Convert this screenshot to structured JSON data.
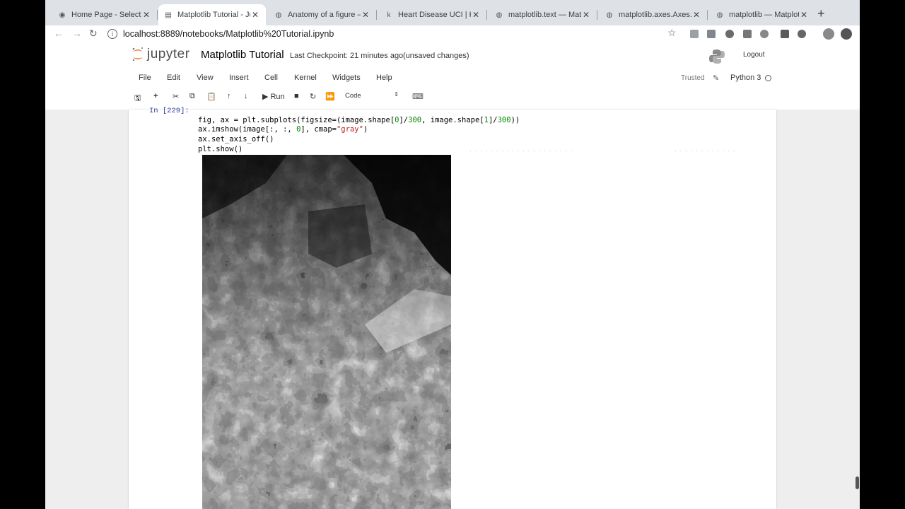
{
  "browser": {
    "tabs": [
      {
        "title": "Home Page - Select or",
        "icon": "jupyter-favicon",
        "active": false
      },
      {
        "title": "Matplotlib Tutorial - Ju",
        "icon": "notebook-favicon",
        "active": true
      },
      {
        "title": "Anatomy of a figure —",
        "icon": "matplotlib-favicon",
        "active": false
      },
      {
        "title": "Heart Disease UCI | K",
        "icon": "kaggle-favicon",
        "active": false
      },
      {
        "title": "matplotlib.text — Mat",
        "icon": "matplotlib-favicon",
        "active": false
      },
      {
        "title": "matplotlib.axes.Axes.t",
        "icon": "matplotlib-favicon",
        "active": false
      },
      {
        "title": "matplotlib — Matplotli",
        "icon": "matplotlib-favicon",
        "active": false
      }
    ],
    "close_glyph": "✕",
    "new_tab_glyph": "+",
    "url": "localhost:8889/notebooks/Matplotlib%20Tutorial.ipynb"
  },
  "jupyter": {
    "logo_text": "jupyter",
    "notebook_title": "Matplotlib Tutorial",
    "checkpoint": "Last Checkpoint: 21 minutes ago",
    "unsaved": "(unsaved changes)",
    "logout": "Logout",
    "menus": [
      "File",
      "Edit",
      "View",
      "Insert",
      "Cell",
      "Kernel",
      "Widgets",
      "Help"
    ],
    "trusted": "Trusted",
    "kernel_name": "Python 3",
    "run_label": "Run",
    "cell_type": "Code"
  },
  "cell": {
    "prompt": "In [229]:",
    "code_lines": [
      "fig, ax = plt.subplots(figsize=(image.shape[0]/300, image.shape[1]/300))",
      "ax.imshow(image[:, :, 0], cmap=\"gray\")",
      "ax.set_axis_off()",
      "plt.show()"
    ]
  },
  "colors": {
    "tabstrip": "#dee1e6",
    "jupyter_orange": "#f37626",
    "prompt_blue": "#303f9f",
    "number_green": "#008000",
    "string_red": "#ba2121"
  }
}
